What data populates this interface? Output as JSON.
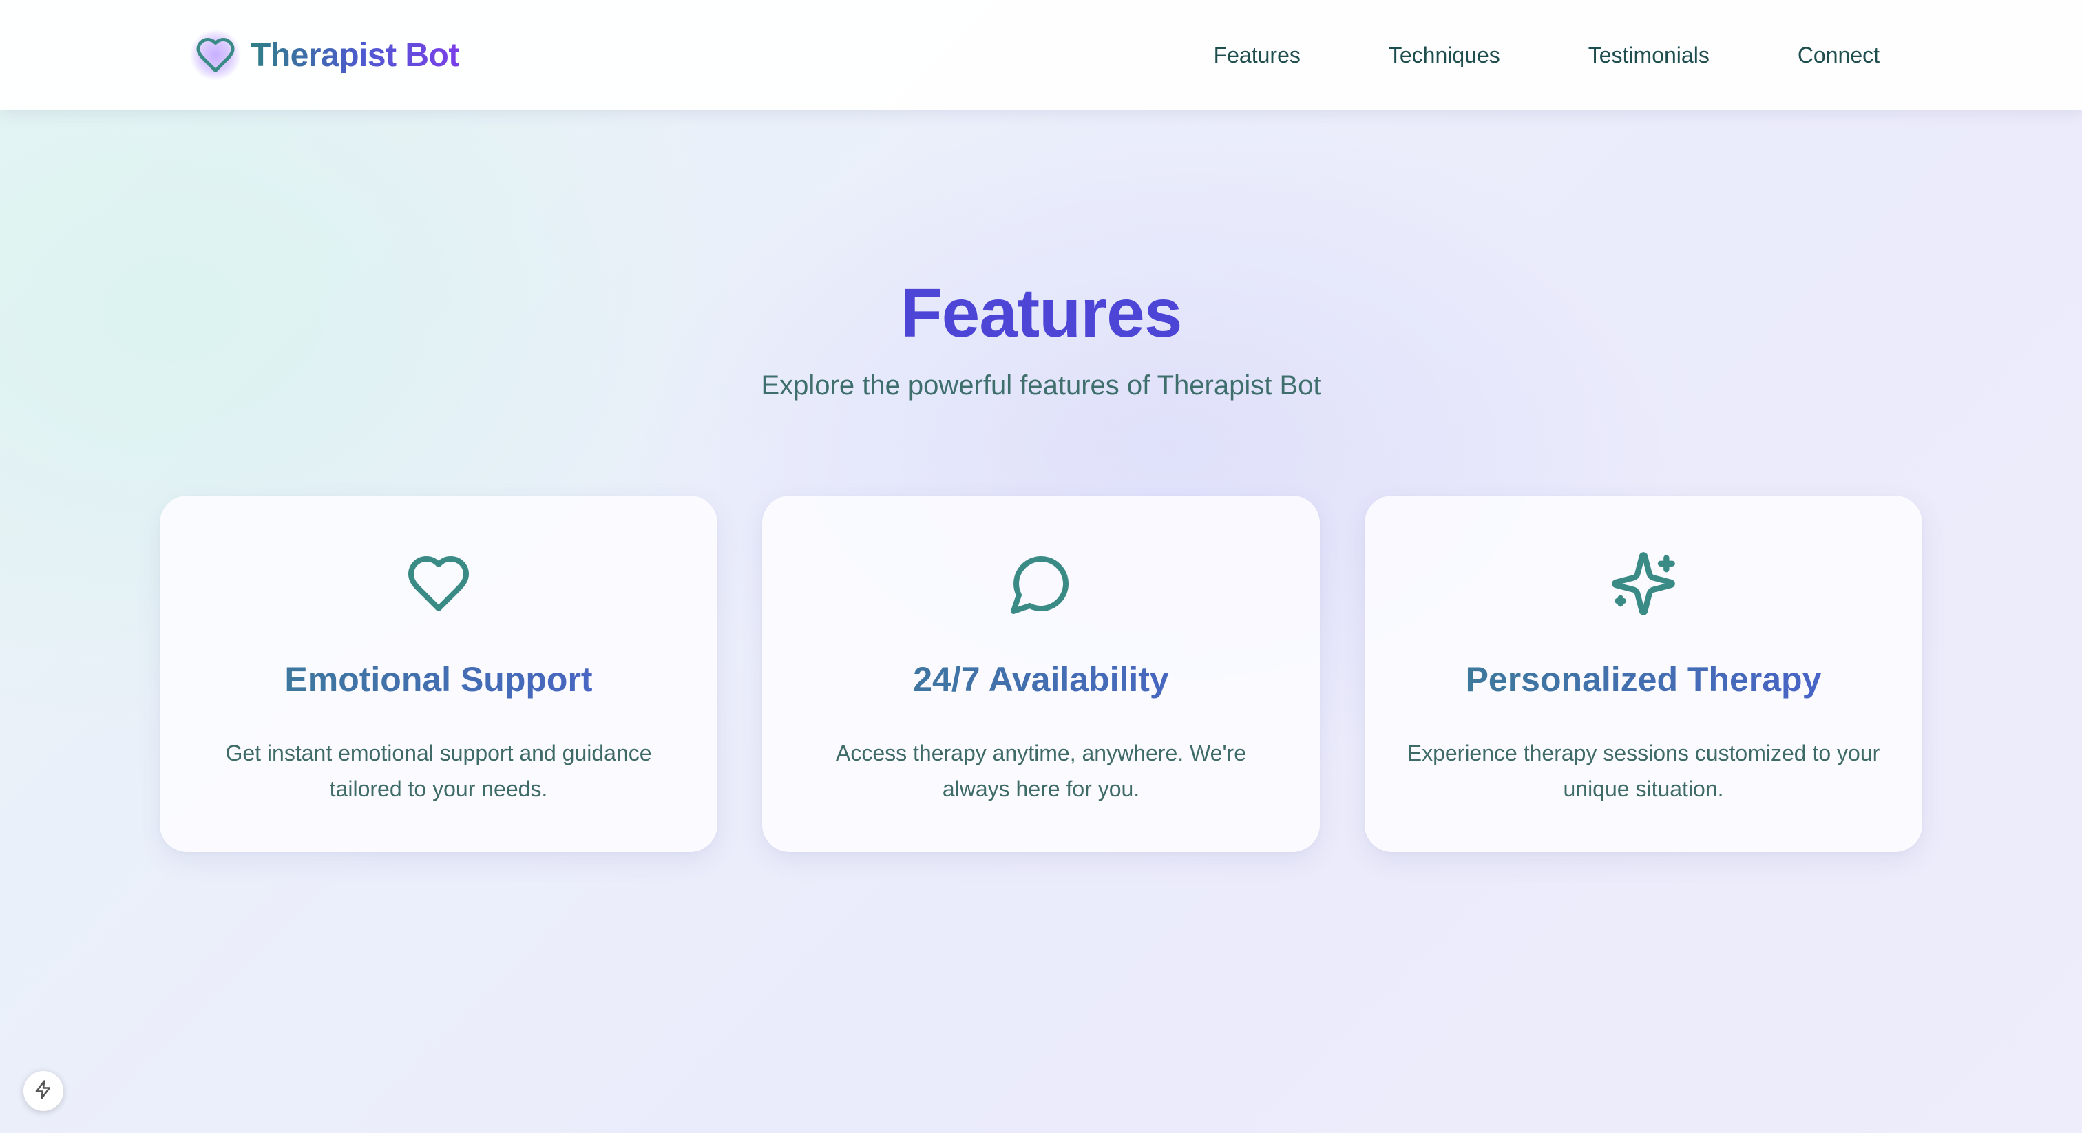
{
  "brand": {
    "name": "Therapist Bot",
    "icon": "heart-icon"
  },
  "nav": {
    "items": [
      {
        "label": "Features"
      },
      {
        "label": "Techniques"
      },
      {
        "label": "Testimonials"
      },
      {
        "label": "Connect"
      }
    ]
  },
  "features": {
    "title": "Features",
    "subtitle": "Explore the powerful features of Therapist Bot",
    "cards": [
      {
        "icon": "heart-icon",
        "title": "Emotional Support",
        "description": "Get instant emotional support and guidance tailored to your needs."
      },
      {
        "icon": "message-circle-icon",
        "title": "24/7 Availability",
        "description": "Access therapy anytime, anywhere. We're always here for you."
      },
      {
        "icon": "sparkles-icon",
        "title": "Personalized Therapy",
        "description": "Experience therapy sessions customized to your unique situation."
      }
    ]
  },
  "badge": {
    "icon": "bolt-icon"
  },
  "colors": {
    "accent_teal": "#3a8a86",
    "accent_indigo": "#4d45d6",
    "accent_purple": "#7b3ee8",
    "nav_text": "#1f4e4e"
  }
}
